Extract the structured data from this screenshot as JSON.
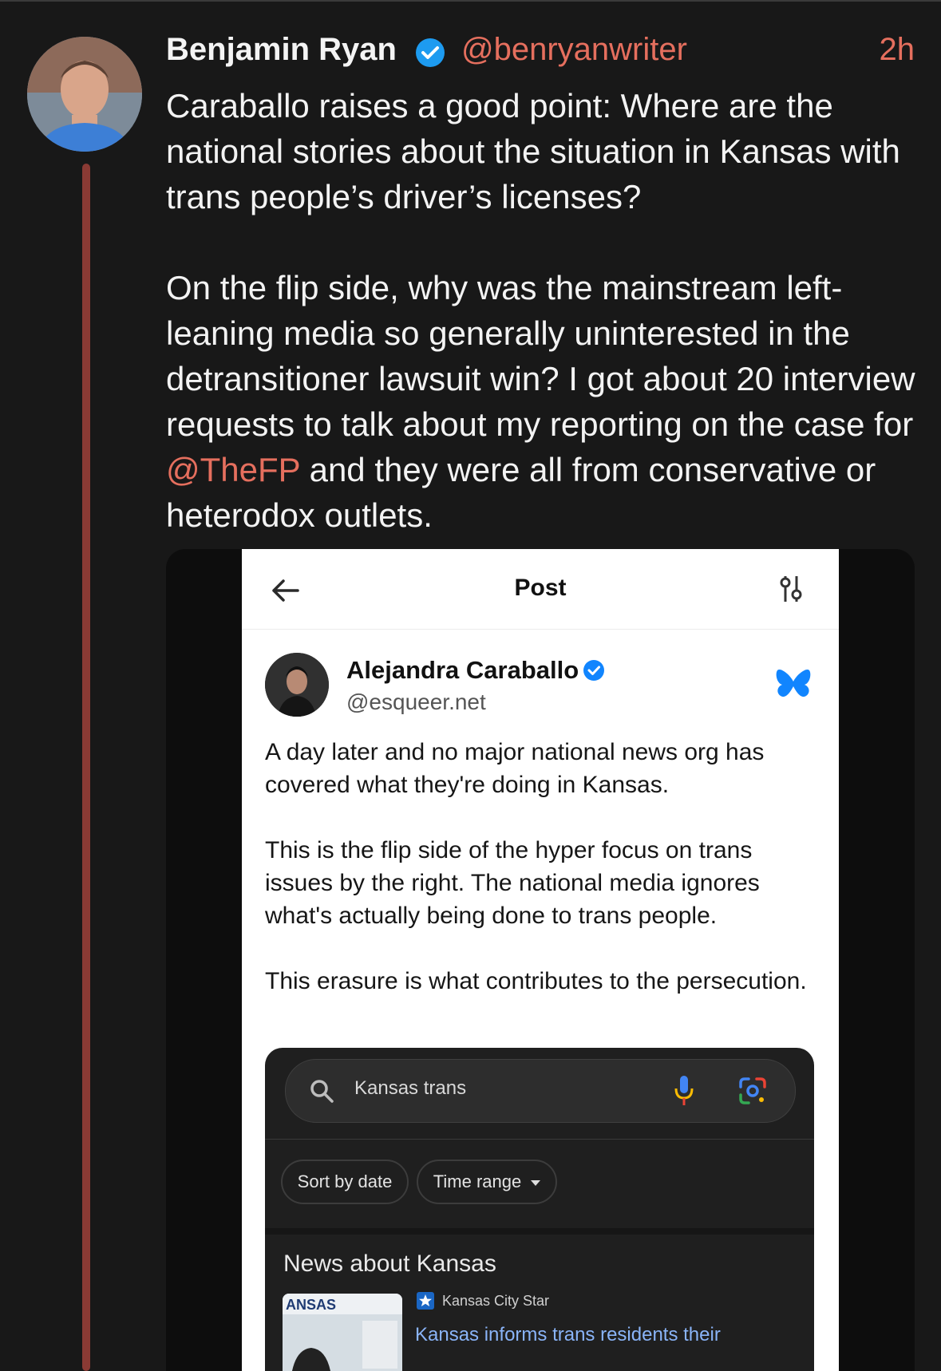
{
  "tweet": {
    "author_name": "Benjamin Ryan",
    "handle": "@benryanwriter",
    "time": "2h",
    "paragraph1": "Caraballo raises a good point: Where are the national stories about the situation in Kansas with trans people’s driver’s licenses?",
    "paragraph2_before": "On the flip side, why was the mainstream left-leaning media so generally uninterested in the detransitioner lawsuit win? I got about 20 interview requests to talk about my reporting on the case for ",
    "paragraph2_mention": "@TheFP",
    "paragraph2_after": " and they were all from conservative or heterodox outlets.",
    "accent_color": "#e56f5e",
    "verified_color": "#1d9bf0"
  },
  "embedded_post": {
    "header_title": "Post",
    "author_name": "Alejandra Caraballo",
    "author_handle": "@esqueer.net",
    "paragraph1": "A day later and no major national news org has covered what they're doing in Kansas.",
    "paragraph2": "This is the flip side of the hyper focus on trans issues by the right. The national media ignores what's actually being done to trans people.",
    "paragraph3": "This erasure is what contributes to the persecution.",
    "platform_color": "#1185fe"
  },
  "google_search": {
    "query": "Kansas trans",
    "chip_sort": "Sort by date",
    "chip_time": "Time range",
    "section_title": "News about Kansas",
    "news_source": "Kansas City Star",
    "news_title": "Kansas informs trans residents their",
    "thumb_text": "ANSAS"
  }
}
